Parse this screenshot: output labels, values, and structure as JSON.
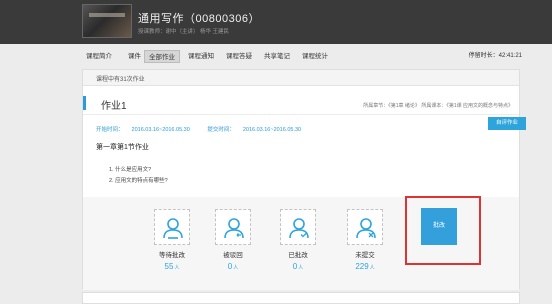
{
  "header": {
    "course_title": "通用写作（00800306）",
    "teacher_line": "授课教师：谢中（主讲）  杨华  王建民"
  },
  "nav": {
    "items": [
      "课程简介",
      "课件",
      "全部作业",
      "课程通知",
      "课程答疑",
      "共享笔记",
      "课程统计"
    ],
    "active_index": 2,
    "time_label": "停留时长：",
    "time_value": "42:41:21"
  },
  "homework": {
    "breadcrumb": "课程中有31次作业",
    "title": "作业1",
    "meta": "所属章节：《第1章 绪论》 所属课本：《第1课 应用文的概念与特点》",
    "start_label": "开始时间：",
    "start_value": "2016.03.16~2016.05.30",
    "due_label": "提交时间：",
    "due_value": "2016.03.16~2016.05.30",
    "tag": "自评作业",
    "section": "第一章第1节作业",
    "questions": [
      "1. 什么是应用文?",
      "2. 应用文的特点有哪些?"
    ]
  },
  "stats": [
    {
      "label": "等待批改",
      "count": "55",
      "unit": "人"
    },
    {
      "label": "被驳回",
      "count": "0",
      "unit": "人"
    },
    {
      "label": "已批改",
      "count": "0",
      "unit": "人"
    },
    {
      "label": "未提交",
      "count": "229",
      "unit": "人"
    }
  ],
  "grade_button": "批改",
  "colors": {
    "accent": "#2ea4dd",
    "highlight_frame": "#dd3333",
    "topbar": "#3a3a3a"
  },
  "icons": [
    "user-clock-icon",
    "user-return-icon",
    "user-check-icon",
    "user-cross-icon"
  ]
}
